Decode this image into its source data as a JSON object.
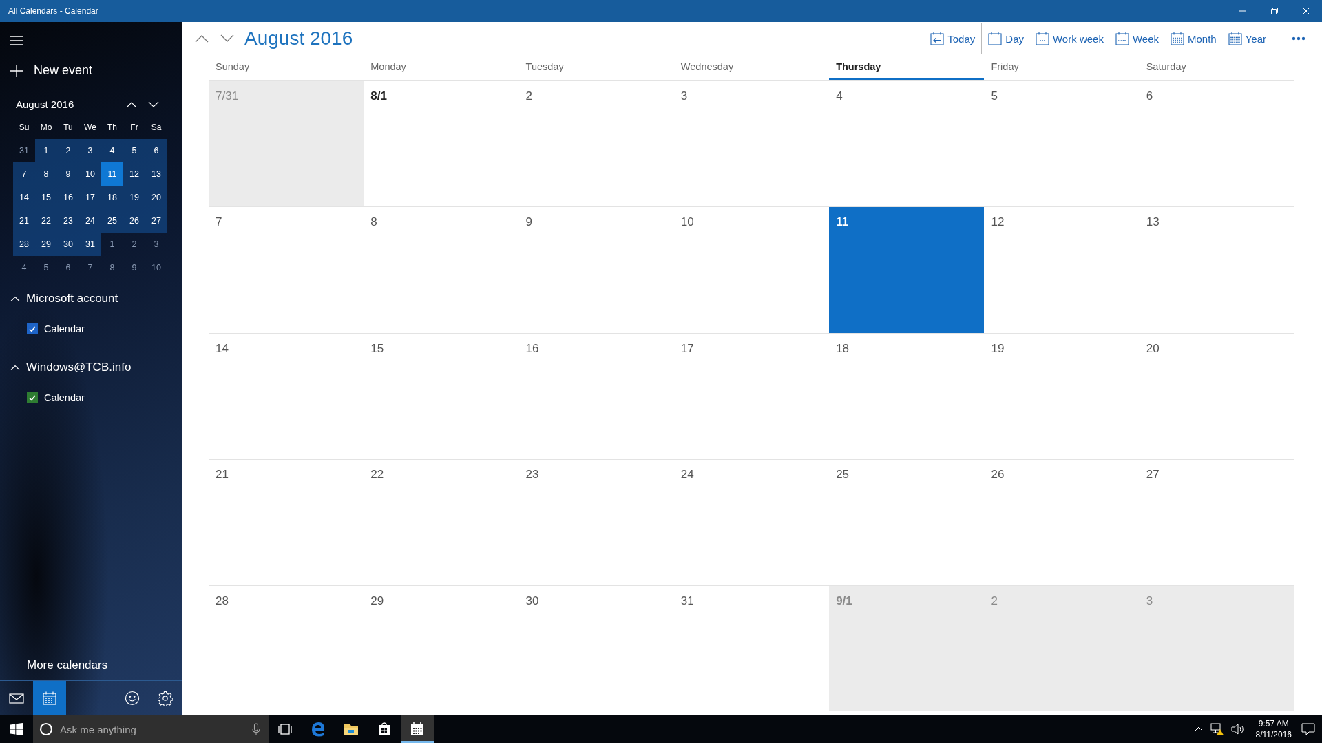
{
  "window": {
    "title": "All Calendars - Calendar"
  },
  "sidebar": {
    "new_event": "New event",
    "mini_calendar": {
      "title": "August 2016",
      "weekdays": [
        "Su",
        "Mo",
        "Tu",
        "We",
        "Th",
        "Fr",
        "Sa"
      ],
      "weeks": [
        [
          {
            "label": "31",
            "in_month": false,
            "selected": false
          },
          {
            "label": "1",
            "in_month": true,
            "selected": false
          },
          {
            "label": "2",
            "in_month": true,
            "selected": false
          },
          {
            "label": "3",
            "in_month": true,
            "selected": false
          },
          {
            "label": "4",
            "in_month": true,
            "selected": false
          },
          {
            "label": "5",
            "in_month": true,
            "selected": false
          },
          {
            "label": "6",
            "in_month": true,
            "selected": false
          }
        ],
        [
          {
            "label": "7",
            "in_month": true,
            "selected": false
          },
          {
            "label": "8",
            "in_month": true,
            "selected": false
          },
          {
            "label": "9",
            "in_month": true,
            "selected": false
          },
          {
            "label": "10",
            "in_month": true,
            "selected": false
          },
          {
            "label": "11",
            "in_month": true,
            "selected": true
          },
          {
            "label": "12",
            "in_month": true,
            "selected": false
          },
          {
            "label": "13",
            "in_month": true,
            "selected": false
          }
        ],
        [
          {
            "label": "14",
            "in_month": true,
            "selected": false
          },
          {
            "label": "15",
            "in_month": true,
            "selected": false
          },
          {
            "label": "16",
            "in_month": true,
            "selected": false
          },
          {
            "label": "17",
            "in_month": true,
            "selected": false
          },
          {
            "label": "18",
            "in_month": true,
            "selected": false
          },
          {
            "label": "19",
            "in_month": true,
            "selected": false
          },
          {
            "label": "20",
            "in_month": true,
            "selected": false
          }
        ],
        [
          {
            "label": "21",
            "in_month": true,
            "selected": false
          },
          {
            "label": "22",
            "in_month": true,
            "selected": false
          },
          {
            "label": "23",
            "in_month": true,
            "selected": false
          },
          {
            "label": "24",
            "in_month": true,
            "selected": false
          },
          {
            "label": "25",
            "in_month": true,
            "selected": false
          },
          {
            "label": "26",
            "in_month": true,
            "selected": false
          },
          {
            "label": "27",
            "in_month": true,
            "selected": false
          }
        ],
        [
          {
            "label": "28",
            "in_month": true,
            "selected": false
          },
          {
            "label": "29",
            "in_month": true,
            "selected": false
          },
          {
            "label": "30",
            "in_month": true,
            "selected": false
          },
          {
            "label": "31",
            "in_month": true,
            "selected": false
          },
          {
            "label": "1",
            "in_month": false,
            "selected": false
          },
          {
            "label": "2",
            "in_month": false,
            "selected": false
          },
          {
            "label": "3",
            "in_month": false,
            "selected": false
          }
        ],
        [
          {
            "label": "4",
            "in_month": false,
            "selected": false
          },
          {
            "label": "5",
            "in_month": false,
            "selected": false
          },
          {
            "label": "6",
            "in_month": false,
            "selected": false
          },
          {
            "label": "7",
            "in_month": false,
            "selected": false
          },
          {
            "label": "8",
            "in_month": false,
            "selected": false
          },
          {
            "label": "9",
            "in_month": false,
            "selected": false
          },
          {
            "label": "10",
            "in_month": false,
            "selected": false
          }
        ]
      ]
    },
    "accounts": [
      {
        "name": "Microsoft account",
        "expanded": true,
        "calendars": [
          {
            "name": "Calendar",
            "checked": true,
            "color": "#1e64c8"
          }
        ]
      },
      {
        "name": "Windows@TCB.info",
        "expanded": true,
        "calendars": [
          {
            "name": "Calendar",
            "checked": true,
            "color": "#2e7d32"
          }
        ]
      }
    ],
    "more_calendars": "More calendars",
    "nav": [
      {
        "kind": "mail",
        "selected": false
      },
      {
        "kind": "calendar",
        "selected": true
      },
      {
        "kind": "feedback",
        "selected": false
      },
      {
        "kind": "settings",
        "selected": false
      }
    ]
  },
  "header": {
    "title": "August 2016",
    "toolbar": [
      {
        "kind": "today",
        "label": "Today"
      },
      {
        "kind": "day",
        "label": "Day"
      },
      {
        "kind": "workweek",
        "label": "Work week"
      },
      {
        "kind": "week",
        "label": "Week"
      },
      {
        "kind": "month",
        "label": "Month"
      },
      {
        "kind": "year",
        "label": "Year"
      }
    ]
  },
  "month": {
    "weekdays": [
      {
        "label": "Sunday",
        "selected": false
      },
      {
        "label": "Monday",
        "selected": false
      },
      {
        "label": "Tuesday",
        "selected": false
      },
      {
        "label": "Wednesday",
        "selected": false
      },
      {
        "label": "Thursday",
        "selected": true
      },
      {
        "label": "Friday",
        "selected": false
      },
      {
        "label": "Saturday",
        "selected": false
      }
    ],
    "weeks": [
      [
        {
          "label": "7/31",
          "outside": true,
          "month_start": false,
          "selected": false
        },
        {
          "label": "8/1",
          "outside": false,
          "month_start": true,
          "selected": false
        },
        {
          "label": "2",
          "outside": false,
          "month_start": false,
          "selected": false
        },
        {
          "label": "3",
          "outside": false,
          "month_start": false,
          "selected": false
        },
        {
          "label": "4",
          "outside": false,
          "month_start": false,
          "selected": false
        },
        {
          "label": "5",
          "outside": false,
          "month_start": false,
          "selected": false
        },
        {
          "label": "6",
          "outside": false,
          "month_start": false,
          "selected": false
        }
      ],
      [
        {
          "label": "7",
          "outside": false,
          "month_start": false,
          "selected": false
        },
        {
          "label": "8",
          "outside": false,
          "month_start": false,
          "selected": false
        },
        {
          "label": "9",
          "outside": false,
          "month_start": false,
          "selected": false
        },
        {
          "label": "10",
          "outside": false,
          "month_start": false,
          "selected": false
        },
        {
          "label": "11",
          "outside": false,
          "month_start": false,
          "selected": true
        },
        {
          "label": "12",
          "outside": false,
          "month_start": false,
          "selected": false
        },
        {
          "label": "13",
          "outside": false,
          "month_start": false,
          "selected": false
        }
      ],
      [
        {
          "label": "14",
          "outside": false,
          "month_start": false,
          "selected": false
        },
        {
          "label": "15",
          "outside": false,
          "month_start": false,
          "selected": false
        },
        {
          "label": "16",
          "outside": false,
          "month_start": false,
          "selected": false
        },
        {
          "label": "17",
          "outside": false,
          "month_start": false,
          "selected": false
        },
        {
          "label": "18",
          "outside": false,
          "month_start": false,
          "selected": false
        },
        {
          "label": "19",
          "outside": false,
          "month_start": false,
          "selected": false
        },
        {
          "label": "20",
          "outside": false,
          "month_start": false,
          "selected": false
        }
      ],
      [
        {
          "label": "21",
          "outside": false,
          "month_start": false,
          "selected": false
        },
        {
          "label": "22",
          "outside": false,
          "month_start": false,
          "selected": false
        },
        {
          "label": "23",
          "outside": false,
          "month_start": false,
          "selected": false
        },
        {
          "label": "24",
          "outside": false,
          "month_start": false,
          "selected": false
        },
        {
          "label": "25",
          "outside": false,
          "month_start": false,
          "selected": false
        },
        {
          "label": "26",
          "outside": false,
          "month_start": false,
          "selected": false
        },
        {
          "label": "27",
          "outside": false,
          "month_start": false,
          "selected": false
        }
      ],
      [
        {
          "label": "28",
          "outside": false,
          "month_start": false,
          "selected": false
        },
        {
          "label": "29",
          "outside": false,
          "month_start": false,
          "selected": false
        },
        {
          "label": "30",
          "outside": false,
          "month_start": false,
          "selected": false
        },
        {
          "label": "31",
          "outside": false,
          "month_start": false,
          "selected": false
        },
        {
          "label": "9/1",
          "outside": true,
          "month_start": true,
          "selected": false
        },
        {
          "label": "2",
          "outside": true,
          "month_start": false,
          "selected": false
        },
        {
          "label": "3",
          "outside": true,
          "month_start": false,
          "selected": false
        }
      ]
    ]
  },
  "taskbar": {
    "search": {
      "placeholder": "Ask me anything"
    },
    "apps": [
      {
        "kind": "task-view",
        "selected": false
      },
      {
        "kind": "edge",
        "selected": false
      },
      {
        "kind": "explorer",
        "selected": false
      },
      {
        "kind": "store",
        "selected": false
      },
      {
        "kind": "calendar",
        "selected": true
      }
    ],
    "time": "9:57 AM",
    "date": "8/11/2016"
  }
}
